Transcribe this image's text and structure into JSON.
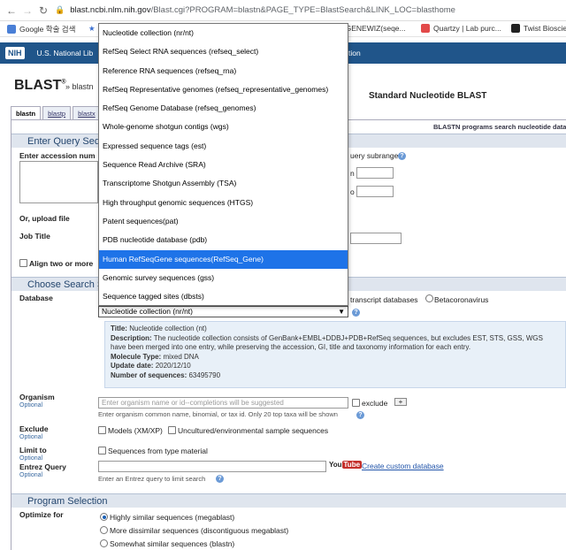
{
  "browser": {
    "url_host": "blast.ncbi.nlm.nih.gov",
    "url_path": "/Blast.cgi?PROGRAM=blastn&PAGE_TYPE=BlastSearch&LINK_LOC=blasthome",
    "bookmarks": [
      "Google 학술 검색",
      "y GENEWIZ(seqe...",
      "Quartzy | Lab purc...",
      "Twist Bioscie"
    ]
  },
  "nih": {
    "logo": "NIH",
    "text_left": "U.S. National Lib",
    "text_right": "tion"
  },
  "header": {
    "title": "BLAST",
    "reg": "®",
    "crumb": "» blastn",
    "standard": "Standard Nucleotide BLAST",
    "program_note": "BLASTN programs search nucleotide data"
  },
  "tabs": [
    "blastn",
    "blastp",
    "blastx"
  ],
  "query": {
    "section": "Enter Query Sequ",
    "accession_label": "Enter accession num",
    "subrange_label": "uery subrange",
    "from_label": "n",
    "to_label": "o",
    "upload_label": "Or, upload file",
    "job_title_label": "Job Title",
    "align_two_label": "Align two or more"
  },
  "search_set": {
    "section": "Choose Search S",
    "database_label": "Database",
    "radio_transcript": "transcript databases",
    "radio_betacorona": "Betacoronavirus",
    "selected_db": "Nucleotide collection (nr/nt)",
    "description": {
      "title_label": "Title:",
      "title_value": "Nucleotide collection (nt)",
      "desc_label": "Description:",
      "desc_value": "The nucleotide collection consists of GenBank+EMBL+DDBJ+PDB+RefSeq sequences, but excludes EST, STS, GSS, WGS",
      "desc_value2": "have been merged into one entry, while preserving the accession, GI, title and taxonomy information for each entry.",
      "molecule_label": "Molecule Type:",
      "molecule_value": "mixed DNA",
      "update_label": "Update date:",
      "update_value": "2020/12/10",
      "num_label": "Number of sequences:",
      "num_value": "63495790"
    },
    "organism_label": "Organism",
    "organism_optional": "Optional",
    "organism_placeholder": "Enter organism name or id--completions will be suggested",
    "exclude_checkbox": "exclude",
    "organism_hint": "Enter organism common name, binomial, or tax id. Only 20 top taxa will be shown",
    "exclude_label": "Exclude",
    "exclude_optional": "Optional",
    "models_label": "Models (XM/XP)",
    "uncultured_label": "Uncultured/environmental sample sequences",
    "limit_label": "Limit to",
    "limit_optional": "Optional",
    "type_material_label": "Sequences from type material",
    "entrez_label": "Entrez Query",
    "entrez_optional": "Optional",
    "youtube_a": "You",
    "youtube_b": "Tube",
    "custom_db_link": "Create custom database",
    "entrez_hint": "Enter an Entrez query to limit search"
  },
  "program": {
    "section": "Program Selection",
    "optimize_label": "Optimize for",
    "options": [
      "Highly similar sequences (megablast)",
      "More dissimilar sequences (discontiguous megablast)",
      "Somewhat similar sequences (blastn)"
    ]
  },
  "dropdown": {
    "items": [
      "Nucleotide collection (nr/nt)",
      "RefSeq Select RNA sequences (refseq_select)",
      "Reference RNA sequences (refseq_rna)",
      "RefSeq Representative genomes (refseq_representative_genomes)",
      "RefSeq Genome Database (refseq_genomes)",
      "Whole-genome shotgun contigs (wgs)",
      "Expressed sequence tags (est)",
      "Sequence Read Archive (SRA)",
      "Transcriptome Shotgun Assembly (TSA)",
      "High throughput genomic sequences (HTGS)",
      "Patent sequences(pat)",
      "PDB nucleotide database (pdb)",
      "Human RefSeqGene sequences(RefSeq_Gene)",
      "Genomic survey sequences (gss)",
      "Sequence tagged sites (dbsts)"
    ],
    "highlighted_index": 12
  },
  "colors": {
    "nih_blue": "#20558a",
    "highlight": "#1e73e8",
    "section_bg": "#dfe5ee",
    "link": "#2255aa"
  }
}
